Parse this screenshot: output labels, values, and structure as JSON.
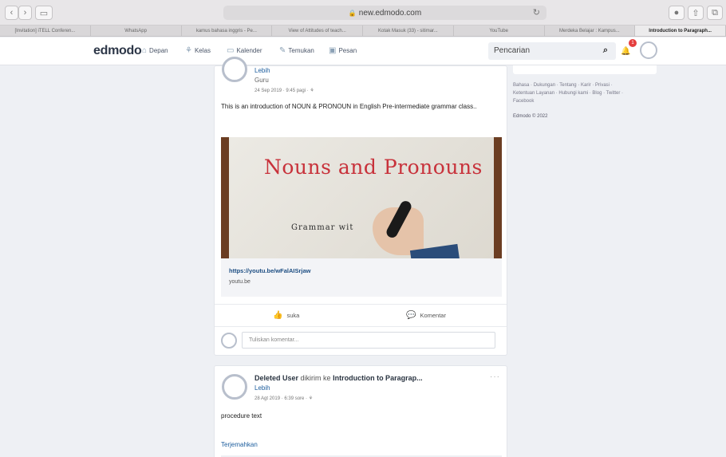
{
  "browser": {
    "url": "new.edmodo.com",
    "tabs": [
      "[Invitation] iTELL Conferen...",
      "WhatsApp",
      "kamus bahasa inggris - Pe...",
      "View of Attitudes of teach...",
      "Kotak Masuk (33) - sitimar...",
      "YouTube",
      "Merdeka Belajar : Kampus...",
      "Introduction to Paragraph..."
    ]
  },
  "nav": {
    "logo": "edmodo",
    "items": [
      "Depan",
      "Kelas",
      "Kalender",
      "Temukan",
      "Pesan"
    ],
    "search_placeholder": "Pencarian",
    "badge": "1"
  },
  "post1": {
    "lebih": "Lebih",
    "role": "Guru",
    "meta": "24 Sep 2019 · 9:45 pagi ·",
    "text": "This is an introduction of NOUN & PRONOUN in English Pre-intermediate grammar class..",
    "video_title": "Nouns and Pronouns",
    "video_sub": "Grammar wit",
    "link_url": "https://youtu.be/wFalAISrjaw",
    "link_domain": "youtu.be",
    "like_label": "suka",
    "comment_label": "Komentar",
    "comment_placeholder": "Tuliskan komentar..."
  },
  "post2": {
    "sender": "Deleted User",
    "sent_to": "dikirim ke",
    "target": "Introduction to Paragrap...",
    "lebih": "Lebih",
    "meta": "28 Agt 2019 · 6:39 sore ·",
    "text": "procedure text",
    "translate": "Terjemahkan",
    "more": "···"
  },
  "footer": {
    "links": [
      "Bahasa",
      "Dukungan",
      "Tentang",
      "Karir",
      "Privasi",
      "Ketentuan Layanan",
      "Hubungi kami",
      "Blog",
      "Twitter",
      "Facebook"
    ],
    "copyright": "Edmodo © 2022"
  }
}
